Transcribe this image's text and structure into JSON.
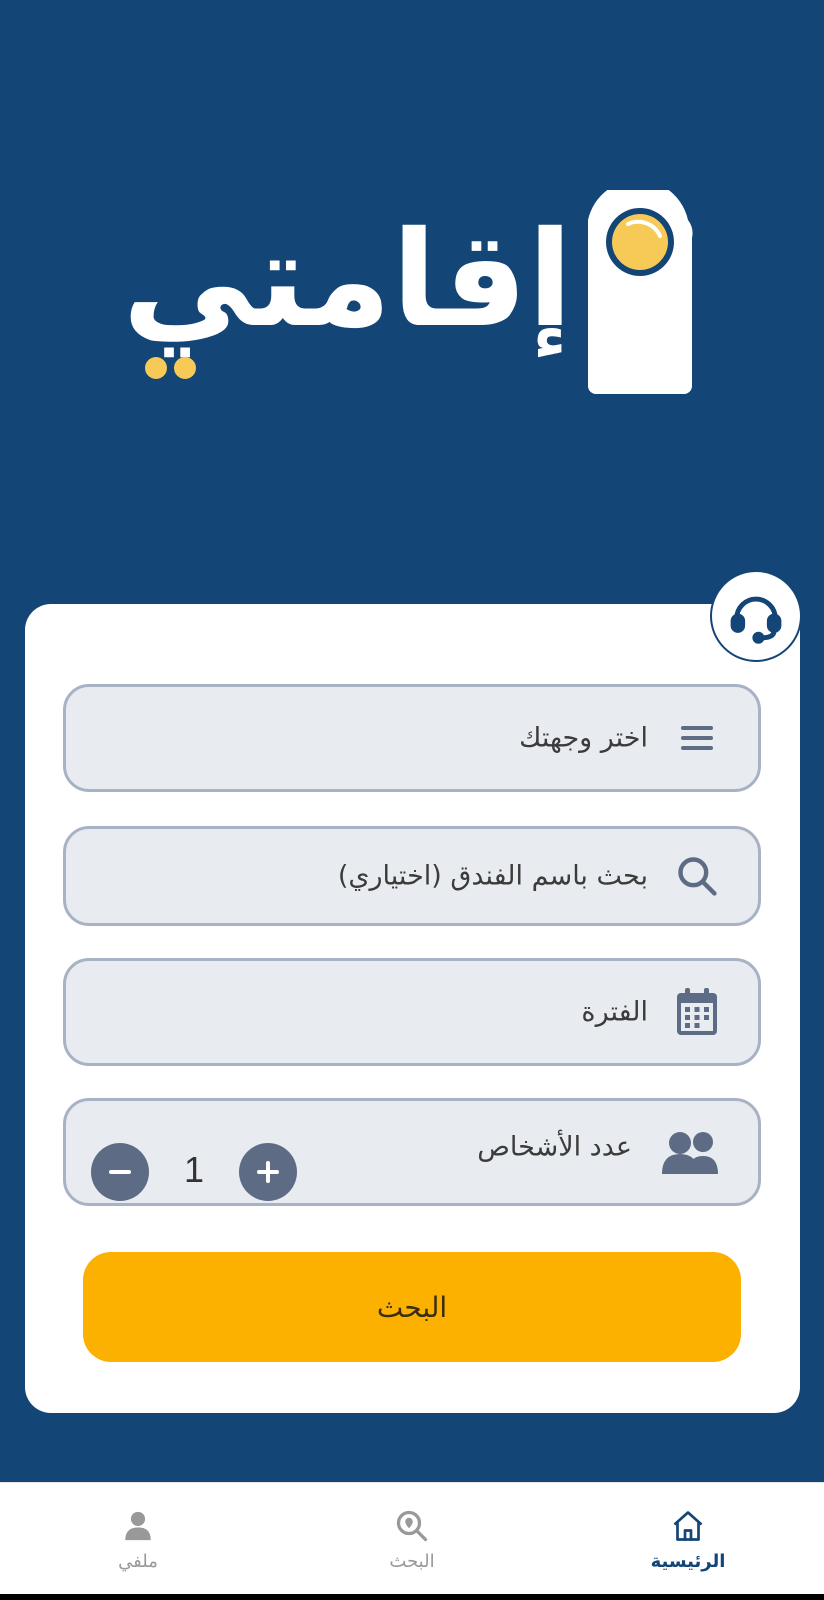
{
  "app": {
    "logo_text": "إقامتي"
  },
  "colors": {
    "background": "#134576",
    "accent": "#fcb101",
    "logo_dot": "#f7c957",
    "field_bg": "#e8ebf0",
    "icon_gray": "#5e6b84"
  },
  "form": {
    "destination_placeholder": "اختر وجهتك",
    "hotel_search_placeholder": "بحث باسم الفندق (اختياري)",
    "period_label": "الفترة",
    "guests_label": "عدد الأشخاص",
    "guests_count": "1",
    "search_button": "البحث"
  },
  "icons": {
    "support": "headset-icon",
    "destination": "menu-icon",
    "hotel_search": "search-icon",
    "period": "calendar-icon",
    "guests": "people-icon",
    "minus": "minus-icon",
    "plus": "plus-icon"
  },
  "nav": {
    "home": "الرئيسية",
    "search": "البحث",
    "profile": "ملفي"
  }
}
